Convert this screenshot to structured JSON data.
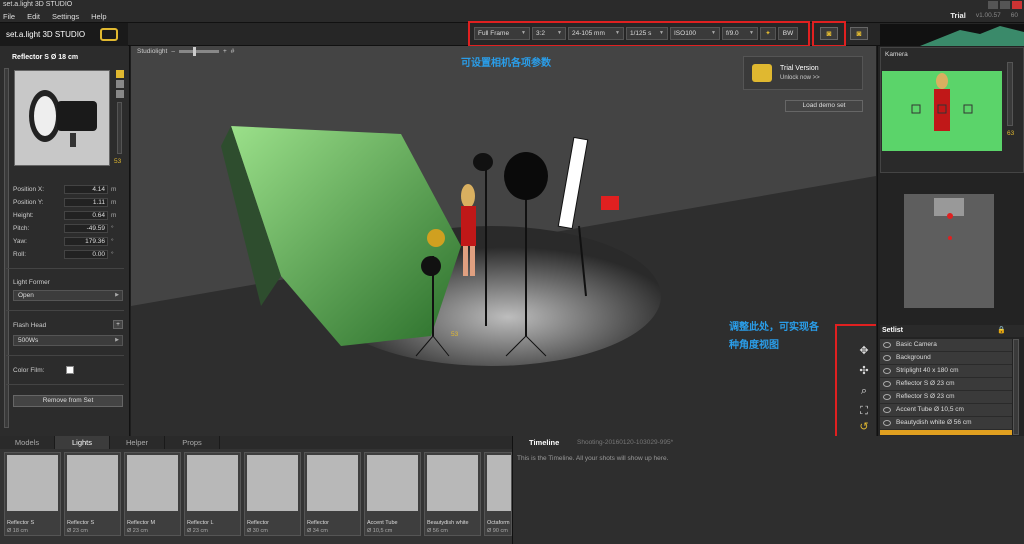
{
  "window": {
    "title": "set.a.light 3D STUDIO"
  },
  "menu": {
    "items": [
      "File",
      "Edit",
      "Settings",
      "Help"
    ],
    "trial_label": "Trial",
    "version": "v1.00.57",
    "fps": "60"
  },
  "logo": {
    "text": "set.a.light 3D STUDIO"
  },
  "camera_settings": {
    "format": "Full Frame",
    "ratio": "3:2",
    "lens": "24-105 mm",
    "shutter": "1/125 s",
    "iso": "ISO100",
    "aperture": "f/9.0",
    "bw": "BW"
  },
  "left_panel": {
    "title": "Reflector S Ø 18 cm",
    "level": "53",
    "props": [
      {
        "label": "Position X:",
        "value": "4.14",
        "unit": "m"
      },
      {
        "label": "Position Y:",
        "value": "1.11",
        "unit": "m"
      },
      {
        "label": "Height:",
        "value": "0.64",
        "unit": "m"
      },
      {
        "label": "Pitch:",
        "value": "-49.59",
        "unit": "°"
      },
      {
        "label": "Yaw:",
        "value": "179.36",
        "unit": "°"
      },
      {
        "label": "Roll:",
        "value": "0.00",
        "unit": "°"
      }
    ],
    "light_former_label": "Light Former",
    "light_former_value": "Open",
    "flash_head_label": "Flash Head",
    "flash_head_value": "500Ws",
    "color_film_label": "Color Film:",
    "remove_button": "Remove from Set"
  },
  "viewport": {
    "studiolight_label": "Studiolight",
    "annot_camera": "可设置相机各项参数",
    "annot_view_line1": "调整此处，可实现各",
    "annot_view_line2": "种角度视图",
    "trial_title": "Trial Version",
    "trial_sub": "Unlock now >>",
    "load_demo": "Load demo set",
    "light_level": "53"
  },
  "right_panel": {
    "kamera_label": "Kamera",
    "kamera_level": "63",
    "setlist_title": "Setlist",
    "setlist": [
      "Basic Camera",
      "Background",
      "Striplight 40 x 180 cm",
      "Reflector S Ø 23 cm",
      "Reflector S Ø 23 cm",
      "Accent Tube Ø 10,5 cm",
      "Beautydish white Ø 56 cm"
    ]
  },
  "bottom": {
    "tabs": [
      "Models",
      "Lights",
      "Helper",
      "Props"
    ],
    "active_tab": "Lights",
    "library": [
      {
        "name": "Reflector S",
        "size": "Ø 18 cm"
      },
      {
        "name": "Reflector S",
        "size": "Ø 23 cm"
      },
      {
        "name": "Reflector M",
        "size": "Ø 23 cm"
      },
      {
        "name": "Reflector L",
        "size": "Ø 23 cm"
      },
      {
        "name": "Reflector",
        "size": "Ø 30 cm"
      },
      {
        "name": "Reflector",
        "size": "Ø 34 cm"
      },
      {
        "name": "Accent Tube",
        "size": "Ø 10,5 cm"
      },
      {
        "name": "Beautydish white",
        "size": "Ø 56 cm"
      },
      {
        "name": "Octaform",
        "size": "Ø 90 cm"
      }
    ],
    "timeline_title": "Timeline",
    "timeline_shoot": "Shooting-20160120-103029-995*",
    "timeline_msg": "This is the Timeline. All your shots will show up here."
  },
  "colors": {
    "accent": "#e0b830",
    "annotation": "#2a9de8",
    "highlight_box": "#e02020",
    "backdrop_green": "#5bd46a"
  }
}
